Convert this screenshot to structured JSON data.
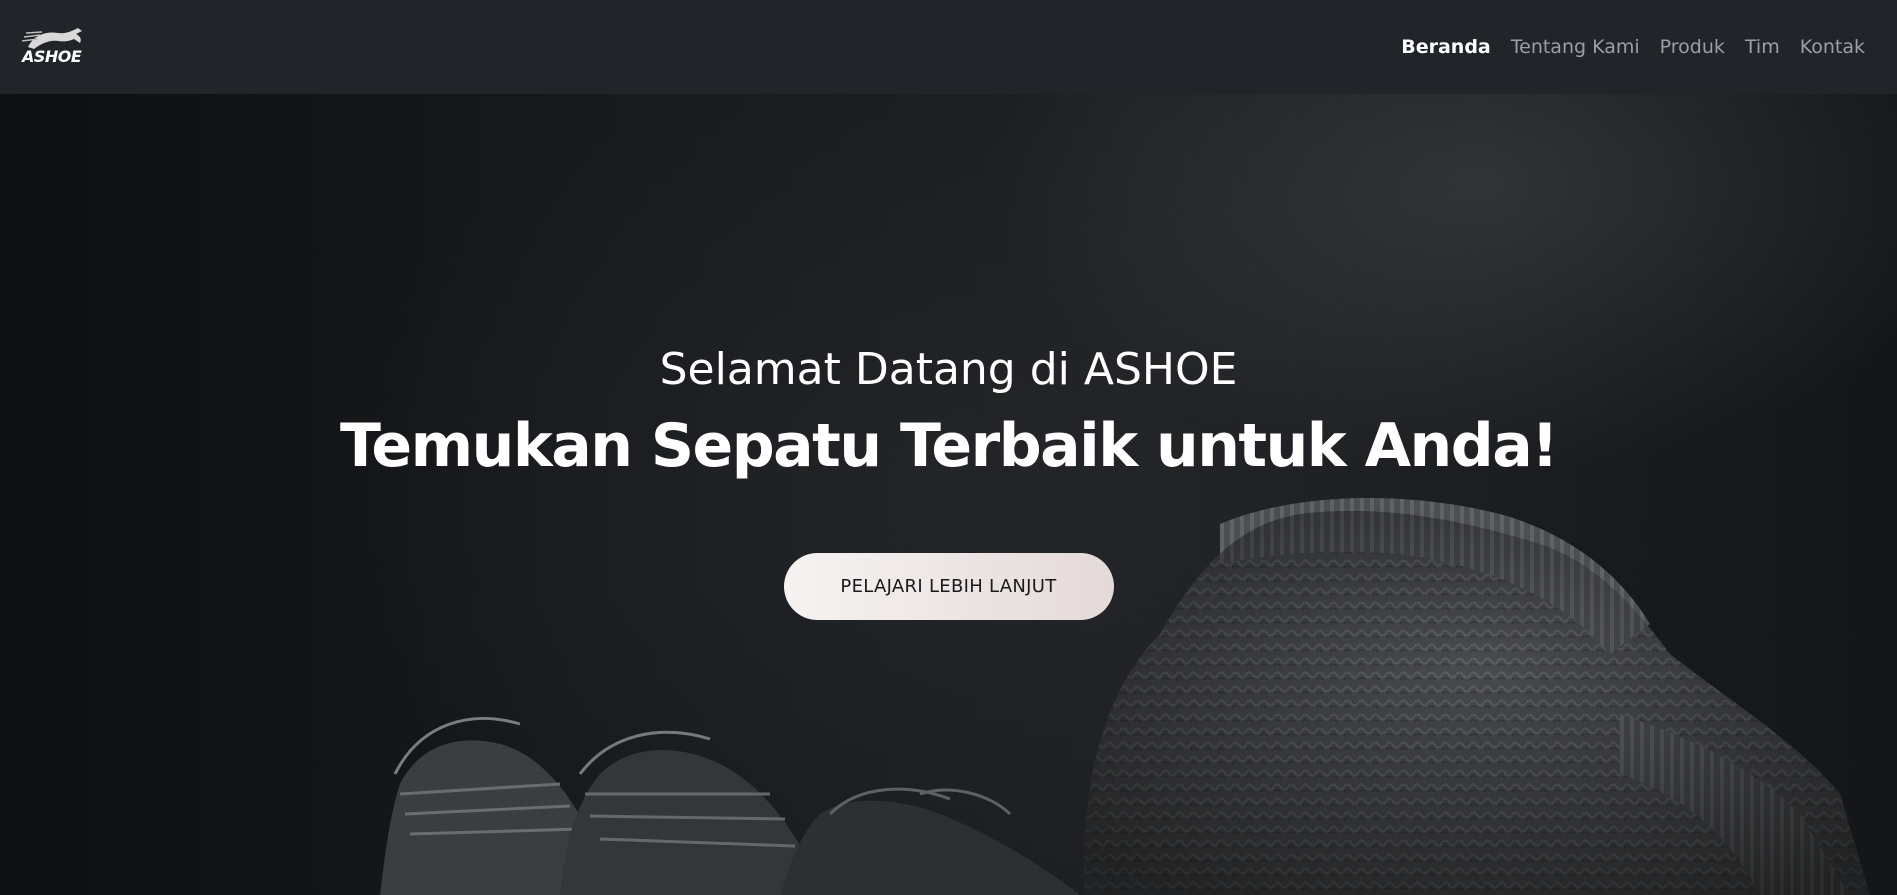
{
  "brand": {
    "logo_text": "ASHOE",
    "logo_icon": "horse-icon"
  },
  "nav": {
    "items": [
      {
        "label": "Beranda",
        "active": true
      },
      {
        "label": "Tentang Kami",
        "active": false
      },
      {
        "label": "Produk",
        "active": false
      },
      {
        "label": "Tim",
        "active": false
      },
      {
        "label": "Kontak",
        "active": false
      }
    ]
  },
  "hero": {
    "subtitle": "Selamat Datang di ASHOE",
    "title": "Temukan Sepatu Terbaik untuk Anda!",
    "cta_label": "PELAJARI LEBIH LANJUT",
    "background_image": "sneakers-and-knit-sweater-photo"
  },
  "colors": {
    "navbar_bg": "#212429",
    "nav_active": "#ffffff",
    "nav_inactive": "#9aa0a6",
    "cta_bg": "#f1ecec",
    "hero_text": "#ffffff"
  }
}
